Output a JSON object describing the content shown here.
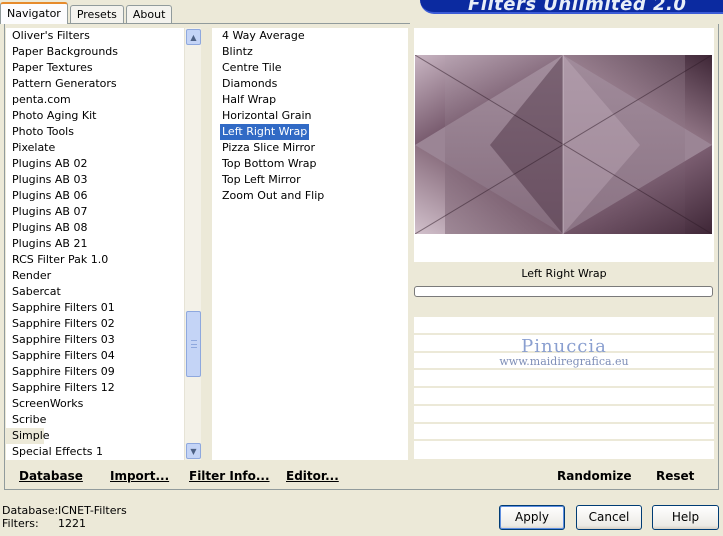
{
  "app": {
    "banner_title": "Filters Unlimited 2.0"
  },
  "tabs": [
    {
      "label": "Navigator",
      "active": true
    },
    {
      "label": "Presets",
      "active": false
    },
    {
      "label": "About",
      "active": false
    }
  ],
  "categories": [
    "Oliver's Filters",
    "Paper Backgrounds",
    "Paper Textures",
    "Pattern Generators",
    "penta.com",
    "Photo Aging Kit",
    "Photo Tools",
    "Pixelate",
    "Plugins AB 02",
    "Plugins AB 03",
    "Plugins AB 06",
    "Plugins AB 07",
    "Plugins AB 08",
    "Plugins AB 21",
    "RCS Filter Pak 1.0",
    "Render",
    "Sabercat",
    "Sapphire Filters 01",
    "Sapphire Filters 02",
    "Sapphire Filters 03",
    "Sapphire Filters 04",
    "Sapphire Filters 09",
    "Sapphire Filters 12",
    "ScreenWorks",
    "Scribe",
    "Simple",
    "Special Effects 1"
  ],
  "selected_category": "Simple",
  "filters": [
    "4 Way Average",
    "Blintz",
    "Centre Tile",
    "Diamonds",
    "Half Wrap",
    "Horizontal Grain",
    "Left Right Wrap",
    "Pizza Slice Mirror",
    "Top Bottom Wrap",
    "Top Left Mirror",
    "Zoom Out and Flip"
  ],
  "selected_filter": "Left Right Wrap",
  "preview": {
    "filter_name": "Left Right Wrap"
  },
  "watermark": {
    "name": "Pinuccia",
    "url": "www.maidiregrafica.eu"
  },
  "toolbar": {
    "database": "Database",
    "import": "Import...",
    "filter_info": "Filter Info...",
    "editor": "Editor...",
    "randomize": "Randomize",
    "reset": "Reset"
  },
  "status": {
    "database_label": "Database:",
    "database_value": "ICNET-Filters",
    "filters_label": "Filters:",
    "filters_value": "1221"
  },
  "buttons": {
    "apply": "Apply",
    "cancel": "Cancel",
    "help": "Help"
  },
  "colors": {
    "selection": "#316ac5",
    "accent_tab": "#e68b2c",
    "banner": "#0b2aa0"
  }
}
